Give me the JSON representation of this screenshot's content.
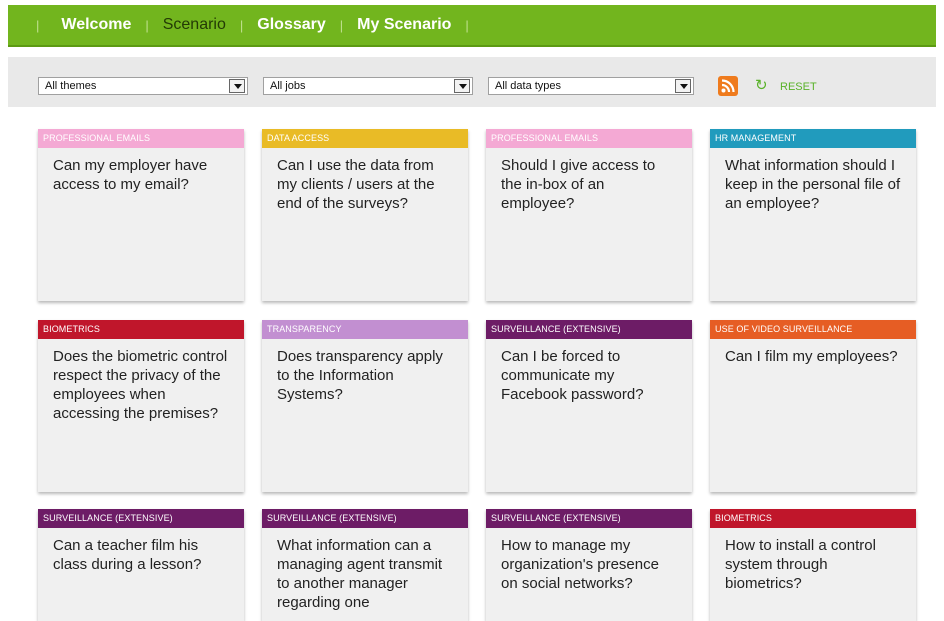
{
  "nav": {
    "items": [
      "Welcome",
      "Scenario",
      "Glossary",
      "My Scenario"
    ],
    "active_index": 1
  },
  "filters": {
    "themes": "All themes",
    "jobs": "All jobs",
    "data_types": "All data types",
    "reset_label": "RESET"
  },
  "colors": {
    "nav_green": "#72b51e",
    "professional_emails": "#f4a9d4",
    "data_access": "#e9bb26",
    "hr_management": "#219bbd",
    "biometrics": "#c0162b",
    "transparency": "#c28fd1",
    "surveillance_extensive": "#6d1c66",
    "video_surveillance": "#e65d24"
  },
  "cards": [
    {
      "category": "PROFESSIONAL EMAILS",
      "color": "#f4a9d4",
      "text_color": "#ffffff",
      "question": "Can my employer have access to my email?"
    },
    {
      "category": "DATA ACCESS",
      "color": "#e9bb26",
      "text_color": "#ffffff",
      "question": "Can I use the data from my clients / users at the end of the surveys?"
    },
    {
      "category": "PROFESSIONAL EMAILS",
      "color": "#f4a9d4",
      "text_color": "#ffffff",
      "question": "Should I give access to the in-box of an employee?"
    },
    {
      "category": "HR MANAGEMENT",
      "color": "#219bbd",
      "text_color": "#ffffff",
      "question": "What information should I keep in the personal file of an employee?"
    },
    {
      "category": "BIOMETRICS",
      "color": "#c0162b",
      "text_color": "#ffffff",
      "question": "Does the biometric control respect the privacy of the employees when accessing the premises?"
    },
    {
      "category": "TRANSPARENCY",
      "color": "#c28fd1",
      "text_color": "#ffffff",
      "question": "Does transparency apply to the Information Systems?"
    },
    {
      "category": "SURVEILLANCE (EXTENSIVE)",
      "color": "#6d1c66",
      "text_color": "#ffffff",
      "question": "Can I be forced to communicate my Facebook password?"
    },
    {
      "category": "USE OF VIDEO SURVEILLANCE",
      "color": "#e65d24",
      "text_color": "#ffffff",
      "question": "Can I film my employees?"
    },
    {
      "category": "SURVEILLANCE (EXTENSIVE)",
      "color": "#6d1c66",
      "text_color": "#ffffff",
      "question": "Can a teacher film his class during a lesson?"
    },
    {
      "category": "SURVEILLANCE (EXTENSIVE)",
      "color": "#6d1c66",
      "text_color": "#ffffff",
      "question": "What information can a managing agent transmit to another manager regarding one"
    },
    {
      "category": "SURVEILLANCE (EXTENSIVE)",
      "color": "#6d1c66",
      "text_color": "#ffffff",
      "question": "How to manage my organization's presence on social networks?"
    },
    {
      "category": "BIOMETRICS",
      "color": "#c0162b",
      "text_color": "#ffffff",
      "question": "How to install a control system through biometrics?"
    }
  ]
}
